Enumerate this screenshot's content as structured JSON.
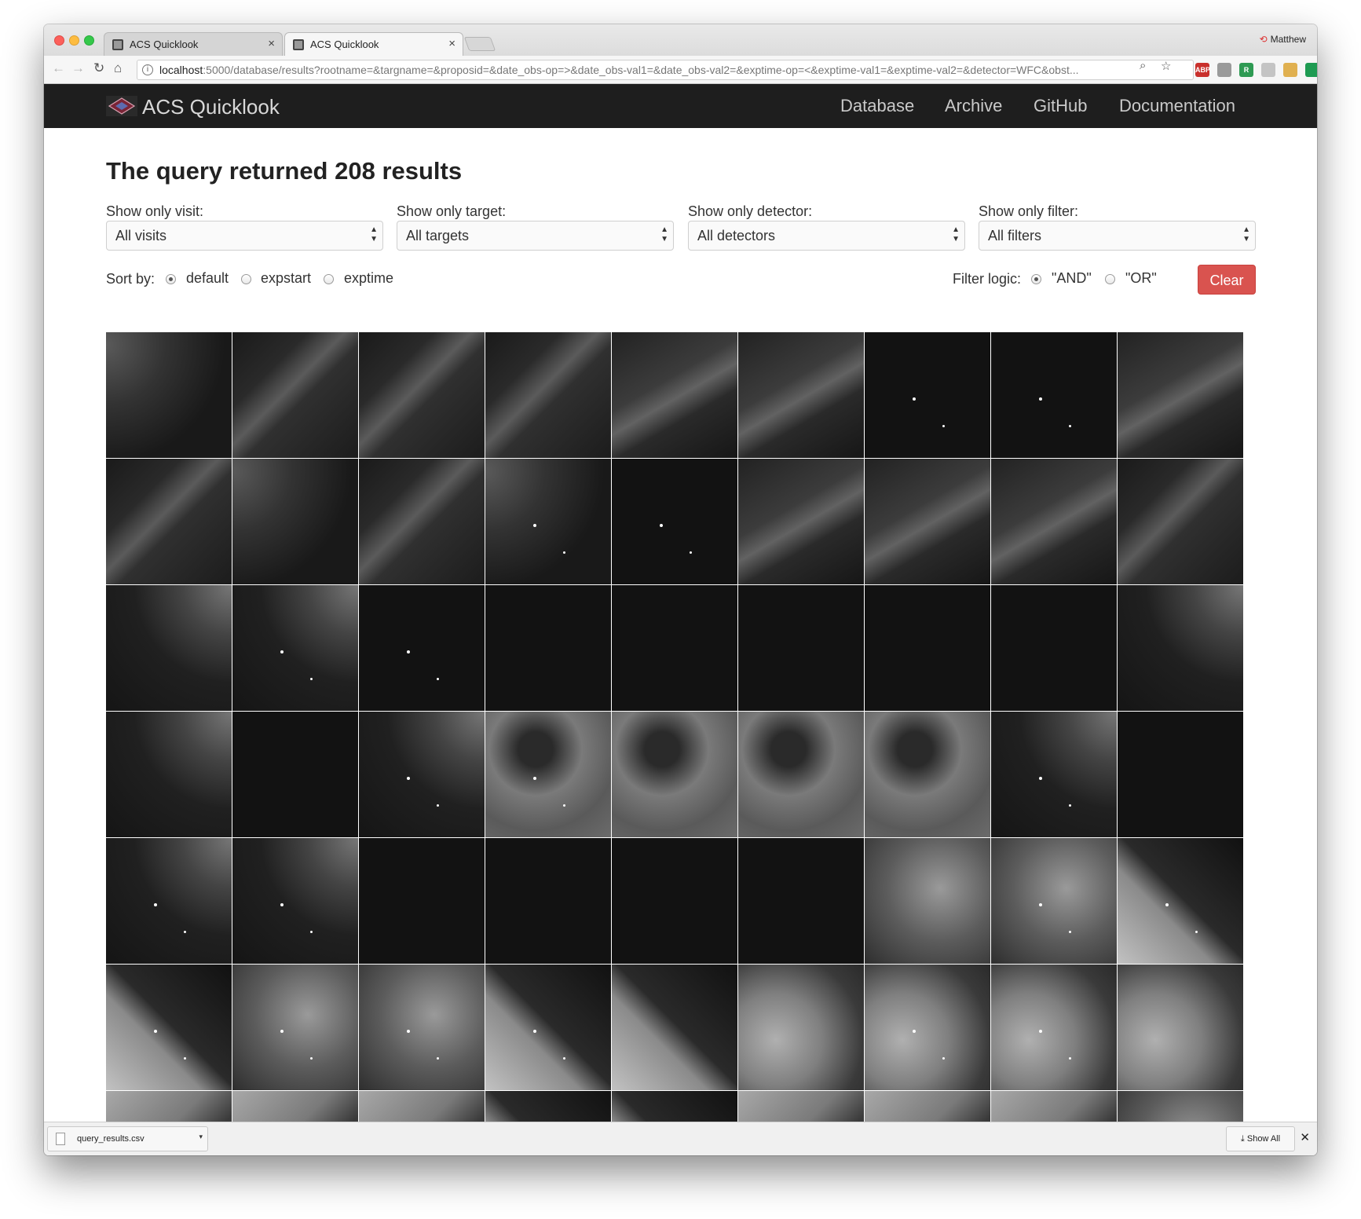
{
  "browser": {
    "tabs": [
      {
        "title": "ACS Quicklook"
      },
      {
        "title": "ACS Quicklook"
      }
    ],
    "profile_name": "Matthew",
    "url_host": "localhost",
    "url_rest": ":5000/database/results?rootname=&targname=&proposid=&date_obs-op=>&date_obs-val1=&date_obs-val2=&exptime-op=<&exptime-val1=&exptime-val2=&detector=WFC&obst...",
    "extensions": [
      {
        "name": "adblock-plus-icon",
        "label": "ABP",
        "color": "#c9302c"
      },
      {
        "name": "extension-gray-icon",
        "label": "",
        "color": "#9a9a9a"
      },
      {
        "name": "extension-r-icon",
        "label": "R",
        "color": "#2e9a53"
      },
      {
        "name": "extension-pale-icon",
        "label": "",
        "color": "#c4c4c4"
      },
      {
        "name": "extension-face-icon",
        "label": "",
        "color": "#e0b050"
      },
      {
        "name": "extension-green-icon",
        "label": "",
        "color": "#1e9b52"
      }
    ]
  },
  "site": {
    "brand": "ACS Quicklook",
    "nav": [
      "Database",
      "Archive",
      "GitHub",
      "Documentation"
    ]
  },
  "main": {
    "heading": "The query returned 208 results",
    "filters": [
      {
        "label": "Show only visit:",
        "value": "All visits"
      },
      {
        "label": "Show only target:",
        "value": "All targets"
      },
      {
        "label": "Show only detector:",
        "value": "All detectors"
      },
      {
        "label": "Show only filter:",
        "value": "All filters"
      }
    ],
    "sort": {
      "label": "Sort by:",
      "options": [
        "default",
        "expstart",
        "exptime"
      ],
      "selected": "default"
    },
    "filter_logic": {
      "label": "Filter logic:",
      "options": [
        "\"AND\"",
        "\"OR\""
      ],
      "selected": "\"AND\""
    },
    "clear_label": "Clear",
    "thumbnails": [
      "neb-tl",
      "wisp",
      "wisp",
      "wisp",
      "wisp2",
      "wisp2",
      "dark",
      "dark",
      "wisp2",
      "wisp",
      "neb-tl",
      "wisp",
      "neb-tl",
      "dark",
      "wisp2",
      "wisp2",
      "wisp2",
      "wisp",
      "neb-tr",
      "neb-tr",
      "dark",
      "dark",
      "dark",
      "dark",
      "dark",
      "dark",
      "neb-tr",
      "neb-tr",
      "dark",
      "neb-tr",
      "pillar",
      "pillar",
      "pillar",
      "pillar",
      "neb-tr",
      "dark",
      "neb-tr",
      "neb-tr",
      "dark",
      "dark",
      "dark",
      "dark",
      "bright3",
      "bright3",
      "edge",
      "edge",
      "bright3",
      "bright3",
      "edge",
      "edge",
      "bright",
      "bright",
      "bright",
      "bright",
      "bright2",
      "bright2",
      "bright2",
      "edge",
      "edge",
      "bright2",
      "bright2",
      "bright2",
      "bright3"
    ]
  },
  "downloads": {
    "file": "query_results.csv",
    "show_all": "Show All"
  }
}
